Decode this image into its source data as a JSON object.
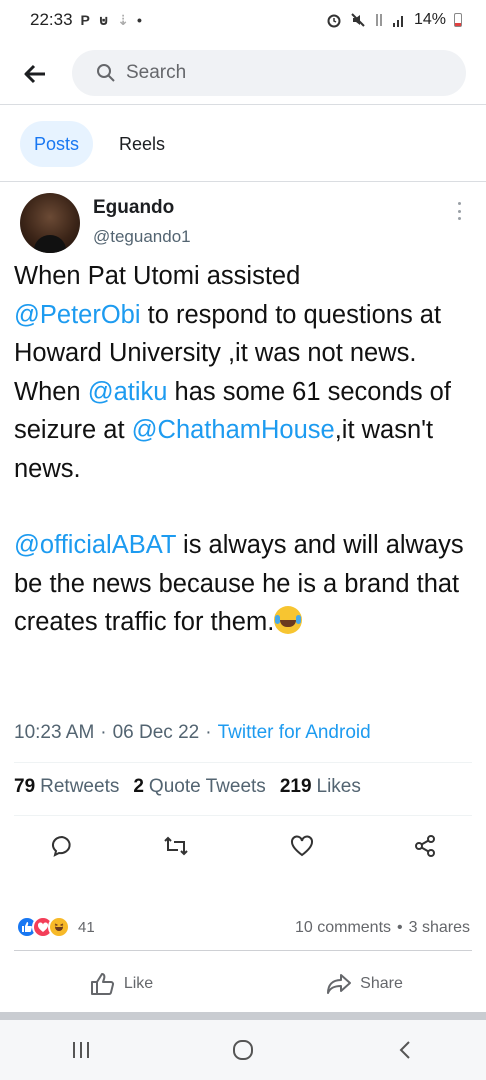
{
  "status_bar": {
    "time": "22:33",
    "left_icons": [
      "P",
      "⊍",
      "⇣",
      "•"
    ],
    "battery": "14%"
  },
  "search": {
    "placeholder": "Search"
  },
  "tabs": [
    {
      "label": "Posts",
      "active": true
    },
    {
      "label": "Reels",
      "active": false
    }
  ],
  "tweet": {
    "author_name": "Eguando",
    "author_handle": "@teguando1",
    "body": {
      "p1_a": "When Pat Utomi assisted",
      "p1_mention_1": "@PeterObi",
      "p1_b": " to respond to questions at Howard University ,it was not news.",
      "p2_a": "When ",
      "p2_mention": "@atiku",
      "p2_b": " has some 61 seconds of seizure at ",
      "p2_mention_2": "@ChathamHouse",
      "p2_c": ",it wasn't news.",
      "p3_mention": "@officialABAT",
      "p3_b": " is always and will always be the news because he is a brand that creates traffic for them."
    },
    "emoji_name": "joy-emoji",
    "time": "10:23 AM",
    "date": "06 Dec 22",
    "app": "Twitter for Android",
    "stats": {
      "retweets_count": "79",
      "retweets_label": "Retweets",
      "quotes_count": "2",
      "quotes_label": "Quote Tweets",
      "likes_count": "219",
      "likes_label": "Likes"
    },
    "actions": [
      "reply-icon",
      "retweet-icon",
      "like-icon",
      "share-icon"
    ]
  },
  "post_footer": {
    "reaction_count": "41",
    "comments": "10 comments",
    "shares": "3 shares",
    "like_label": "Like",
    "share_label": "Share"
  },
  "colors": {
    "facebook_blue": "#1877f2",
    "twitter_blue": "#1d9bf0",
    "tab_active_bg": "#e7f3ff"
  }
}
